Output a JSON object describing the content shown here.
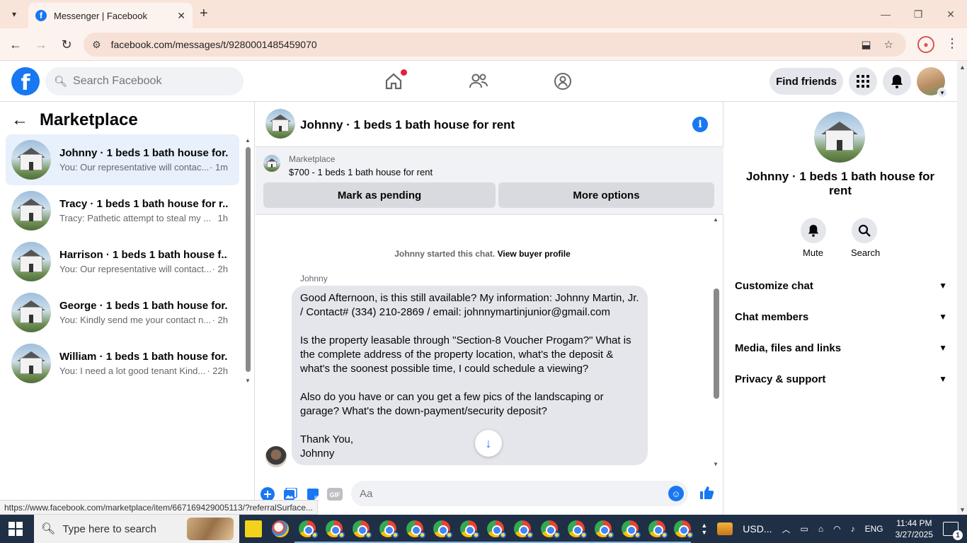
{
  "browser": {
    "tab_title": "Messenger | Facebook",
    "url": "facebook.com/messages/t/9280001485459070",
    "status_url": "https://www.facebook.com/marketplace/item/667169429005113/?referralSurface..."
  },
  "fb_header": {
    "search_placeholder": "Search Facebook",
    "find_friends": "Find friends"
  },
  "left": {
    "title": "Marketplace",
    "conversations": [
      {
        "name": "Johnny · 1 beds 1 bath house for...",
        "snippet": "You: Our representative will contac...",
        "time": "· 1m",
        "active": true
      },
      {
        "name": "Tracy · 1 beds 1 bath house for r...",
        "snippet": "Tracy: Pathetic attempt to steal my ...",
        "time": "1h",
        "active": false
      },
      {
        "name": "Harrison · 1 beds 1 bath house f...",
        "snippet": "You: Our representative will contact...",
        "time": "· 2h",
        "active": false
      },
      {
        "name": "George · 1 beds 1 bath house for...",
        "snippet": "You: Kindly send me your contact n...",
        "time": "· 2h",
        "active": false
      },
      {
        "name": "William · 1 beds 1 bath house for...",
        "snippet": "You: I need a lot good tenant Kind...",
        "time": "· 22h",
        "active": false
      }
    ]
  },
  "chat": {
    "title": "Johnny · 1 beds 1 bath house for rent",
    "marketplace_label": "Marketplace",
    "listing": "$700 - 1 beds 1 bath house for rent",
    "mark_pending": "Mark as pending",
    "more_options": "More options",
    "started_text": "Johnny started this chat.",
    "view_profile": "View buyer profile",
    "sender": "Johnny",
    "message": "Good Afternoon, is this still available? My information: Johnny Martin, Jr. / Contact# (334) 210-2869 / email: johnnymartinjunior@gmail.com\n\nIs the property leasable through \"Section-8 Voucher Progam?\" What is the complete address of the property location, what's the deposit & what's the soonest possible time, I could schedule a viewing?\n\nAlso do you have or can you get a few pics of the landscaping or garage? What's the down-payment/security deposit?\n\nThank You,\nJohnny",
    "composer_placeholder": "Aa"
  },
  "right": {
    "name": "Johnny · 1 beds 1 bath house for rent",
    "mute": "Mute",
    "search": "Search",
    "sections": [
      "Customize chat",
      "Chat members",
      "Media, files and links",
      "Privacy & support"
    ]
  },
  "taskbar": {
    "search_placeholder": "Type here to search",
    "tray_currency": "USD...",
    "lang": "ENG",
    "time": "11:44 PM",
    "date": "3/27/2025",
    "notif_count": "1"
  },
  "colors": {
    "brand": "#1877f2",
    "active_row": "#e7f0fb",
    "taskbar": "#1f2f45",
    "tab_strip": "#f9e4da"
  }
}
